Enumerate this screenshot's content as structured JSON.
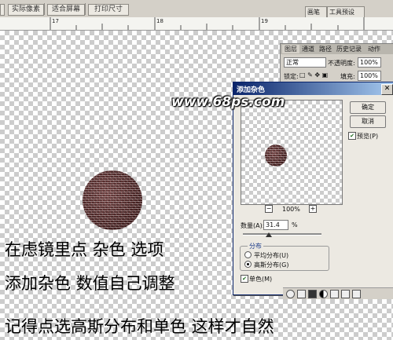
{
  "toolbar": {
    "buttons": [
      "实际像素",
      "适合屏幕",
      "打印尺寸"
    ],
    "panel_tabs": [
      "画笔",
      "工具预设"
    ]
  },
  "ruler": {
    "labels": [
      "17",
      "18",
      "19"
    ]
  },
  "layers_panel": {
    "tabs": [
      "图层",
      "通道",
      "路径",
      "历史记录",
      "动作"
    ],
    "blend_mode": "正常",
    "opacity_label": "不透明度:",
    "opacity_value": "100%",
    "lock_label": "锁定:",
    "fill_label": "填充:",
    "fill_value": "100%"
  },
  "dialog": {
    "title": "添加杂色",
    "ok_label": "确定",
    "cancel_label": "取消",
    "preview_label": "预览(P)",
    "preview_checked": true,
    "zoom_value": "100%",
    "amount_label": "数量(A):",
    "amount_value": "31.4",
    "amount_unit": "%",
    "distribution_label": "分布",
    "uniform_label": "平均分布(U)",
    "gaussian_label": "高斯分布(G)",
    "distribution_selected": "gaussian",
    "monochrome_label": "单色(M)",
    "monochrome_checked": true
  },
  "watermark": "www.68ps.com",
  "captions": [
    "在虑镜里点  杂色  选项",
    "添加杂色  数值自己调整",
    "记得点选高斯分布和单色  这样才自然"
  ],
  "colors": {
    "title_bar": "#0a246a",
    "noise_fill": "#5a2a2a"
  }
}
